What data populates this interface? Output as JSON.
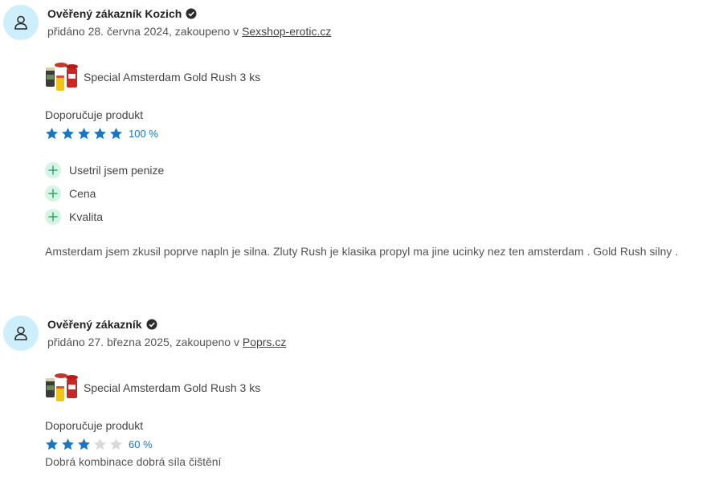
{
  "reviews": [
    {
      "author": "Ověřený zákazník Kozich",
      "meta_prefix": "přidáno 28. června 2024, zakoupeno v ",
      "shop": "Sexshop-erotic.cz",
      "product_name": "Special Amsterdam Gold Rush 3 ks",
      "recommend_label": "Doporučuje produkt",
      "rating_stars": 5,
      "rating_max": 5,
      "rating_percent": "100 %",
      "pros": [
        "Usetril jsem penize",
        "Cena",
        "Kvalita"
      ],
      "text": "Amsterdam jsem zkusil poprve napln je silna. Zluty Rush je klasika propyl ma jine ucinky nez ten amsterdam . Gold Rush silny ."
    },
    {
      "author": "Ověřený zákazník",
      "meta_prefix": "přidáno 27. března 2025, zakoupeno v ",
      "shop": "Poprs.cz",
      "product_name": "Special Amsterdam Gold Rush 3 ks",
      "recommend_label": "Doporučuje produkt",
      "rating_stars": 3,
      "rating_max": 5,
      "rating_percent": "60 %",
      "text": "Dobrá kombinace dobrá síla čištění"
    }
  ],
  "colors": {
    "avatar_bg": "#cdeefb",
    "star_filled": "#1777c4",
    "star_empty": "#d9d9d9",
    "pro_icon_bg": "#d5f5e4",
    "pro_icon_fg": "#2fa36b"
  }
}
